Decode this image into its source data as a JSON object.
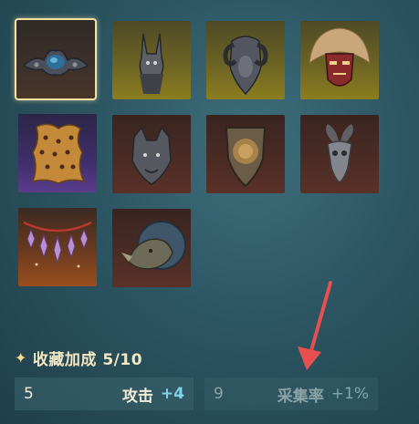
{
  "collection": {
    "slots": [
      {
        "item": "ornate-crown-jewel-icon",
        "rarity": "dark",
        "selected": true
      },
      {
        "item": "anubis-jackal-head-trophy-icon",
        "rarity": "gold"
      },
      {
        "item": "ram-head-trophy-icon",
        "rarity": "gold"
      },
      {
        "item": "feathered-tribal-mask-icon",
        "rarity": "gold"
      },
      {
        "item": "leopard-pelt-icon",
        "rarity": "purple"
      },
      {
        "item": "wolf-head-trophy-icon",
        "rarity": "rust"
      },
      {
        "item": "lion-shield-icon",
        "rarity": "rust"
      },
      {
        "item": "goat-skull-icon",
        "rarity": "rust"
      },
      {
        "item": "crystal-garland-icon",
        "rarity": "orange"
      },
      {
        "item": "rhino-head-trophy-icon",
        "rarity": "rust"
      }
    ]
  },
  "bonus": {
    "title": "收藏加成 5/10",
    "stats": [
      {
        "value": "5",
        "name": "攻击",
        "delta": "+4",
        "active": true
      },
      {
        "value": "9",
        "name": "采集率",
        "delta": "+1%",
        "active": false
      }
    ]
  },
  "colors": {
    "accent": "#f4e3a0",
    "active_delta": "#7fd4e8",
    "annotation_arrow": "#e8504f"
  }
}
